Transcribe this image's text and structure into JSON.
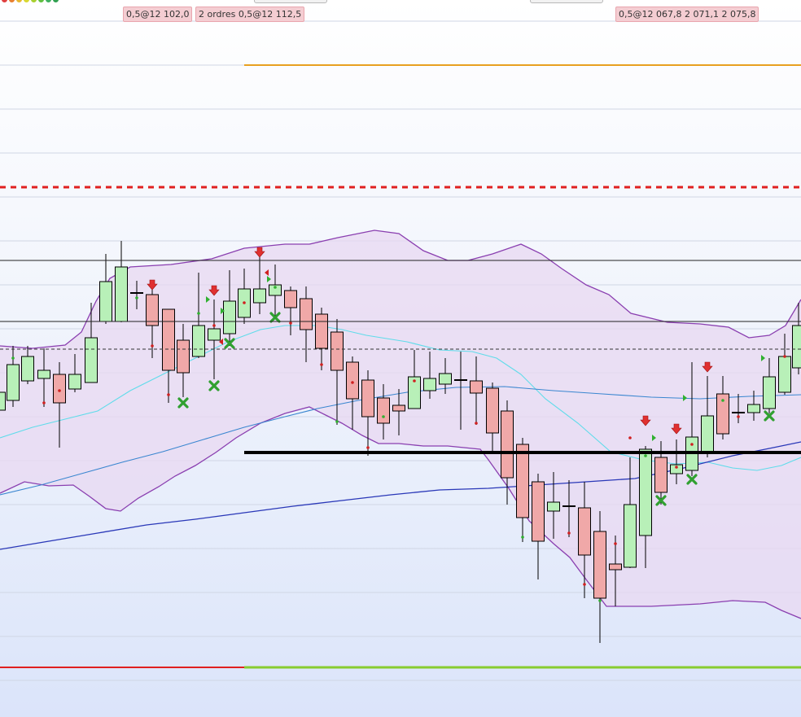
{
  "order_tags": [
    {
      "id": "order-tag-1",
      "text": "0,5@12 102,0"
    },
    {
      "id": "order-tag-2",
      "text": "2 ordres  0,5@12 112,5"
    },
    {
      "id": "order-tag-3",
      "text": "0,5@12 067,8 2 071,1 2 075,8"
    }
  ],
  "colors": {
    "bull_fill": "#b8f0b8",
    "bear_fill": "#f0a8a8",
    "candle_border": "#000000",
    "bollinger": "#8a3fb0",
    "bollinger_fill": "#e8d8f2",
    "ma_cyan": "#5fdcea",
    "ma_blue": "#3a86d0",
    "ma_navy": "#2a38b8",
    "orange_level": "#e8a020",
    "red_dashed_level": "#e02020",
    "support_level": "#000000",
    "bottom_red_level": "#e02020",
    "bottom_green_level": "#88cc30",
    "sell_arrow": "#e03030",
    "exit_marker": "#30a030"
  },
  "icons": {
    "sell_signal": "arrow-down-icon",
    "exit_signal": "cross-icon",
    "entry_signal": "triangle-right-icon"
  }
}
